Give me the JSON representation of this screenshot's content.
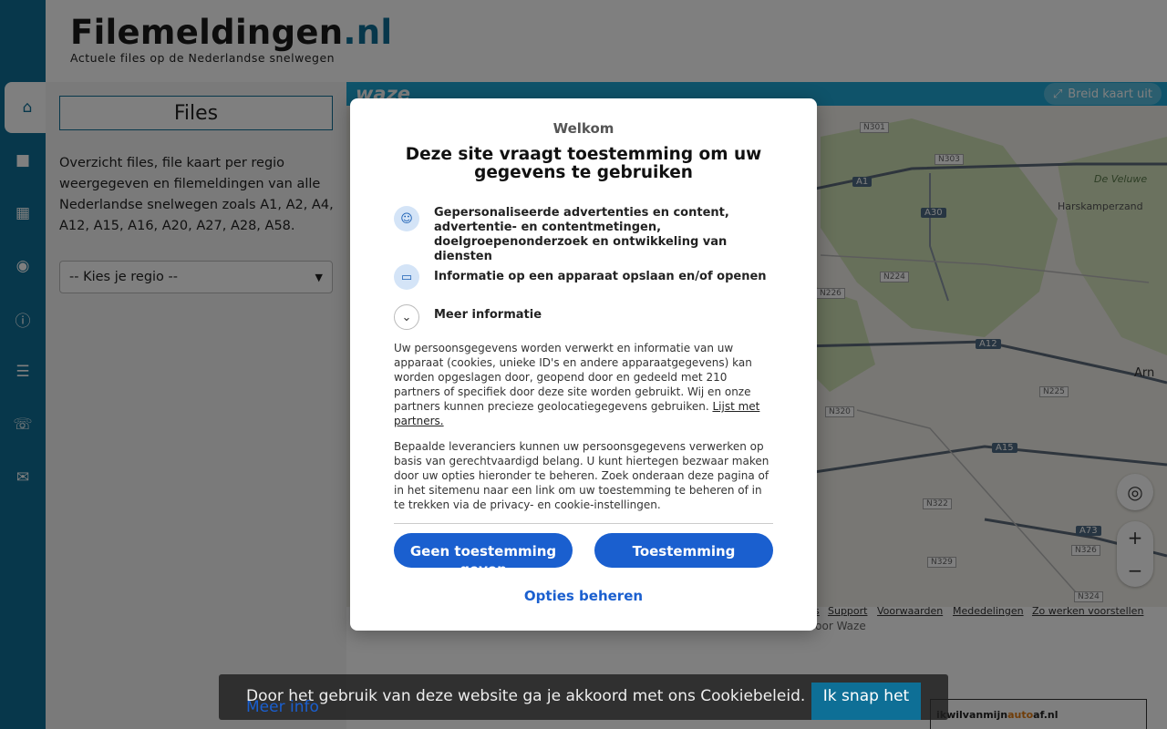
{
  "header": {
    "logo_main": "Filemeldingen",
    "logo_tld": ".nl",
    "tagline": "Actuele files op de Nederlandse snelwegen"
  },
  "rail": {
    "icons": [
      "home-icon",
      "car-icon",
      "map-icon",
      "camera-icon",
      "info-icon",
      "list-icon",
      "phone-icon",
      "mail-icon"
    ]
  },
  "panel": {
    "files_label": "Files",
    "intro": "Overzicht files, file kaart per regio weergegeven en filemeldingen van alle Nederlandse snelwegen zoals A1, A2, A4, A12, A15, A16, A20, A27, A28, A58.",
    "region_select": "-- Kies je regio --"
  },
  "map": {
    "waze_logo": "waze",
    "breid_label": "Breid kaart uit",
    "footer_links": [
      "s",
      "Support",
      "Voorwaarden",
      "Mededelingen",
      "Zo werken voorstellen"
    ],
    "powered": "t door Waze",
    "labels": [
      {
        "text": "A1"
      },
      {
        "text": "A30"
      },
      {
        "text": "A12"
      },
      {
        "text": "A15"
      },
      {
        "text": "A73"
      },
      {
        "text": "N301"
      },
      {
        "text": "N303"
      },
      {
        "text": "N224"
      },
      {
        "text": "N226"
      },
      {
        "text": "N225"
      },
      {
        "text": "N320"
      },
      {
        "text": "N322"
      },
      {
        "text": "N326"
      },
      {
        "text": "N329"
      },
      {
        "text": "N324"
      },
      {
        "text": "Harskamperzand"
      },
      {
        "text": "De Veluwe"
      },
      {
        "text": "Arn"
      }
    ]
  },
  "modal": {
    "welcome": "Welkom",
    "title": "Deze site vraagt toestemming om uw gegevens te gebruiken",
    "purpose_1": "Gepersonaliseerde advertenties en content, advertentie- en contentmetingen, doelgroepenonderzoek en ontwikkeling van diensten",
    "purpose_2": "Informatie op een apparaat opslaan en/of openen",
    "more_info": "Meer informatie",
    "body_1": "Uw persoonsgegevens worden verwerkt en informatie van uw apparaat (cookies, unieke ID's en andere apparaatgegevens) kan worden opgeslagen door, geopend door en gedeeld met 210 partners of specifiek door deze site worden gebruikt. Wij en onze partners kunnen precieze geolocatiegegevens gebruiken.",
    "partners_link": "Lijst met partners.",
    "body_2": "Bepaalde leveranciers kunnen uw persoonsgegevens verwerken op basis van gerechtvaardigd belang. U kunt hiertegen bezwaar maken door uw opties hieronder te beheren. Zoek onderaan deze pagina of in het sitemenu naar een link om uw toestemming te beheren of in te trekken via de privacy- en cookie-instellingen.",
    "decline_button": "Geen toestemming geven",
    "accept_button": "Toestemming",
    "manage_button": "Opties beheren"
  },
  "cookie_bar": {
    "text": "Door het gebruik van deze website ga je akkoord met ons Cookiebeleid.",
    "more": "Meer info",
    "button": "Ik snap het"
  },
  "ads": {
    "ad_prefix": "ikwilvanmijn",
    "ad_highlight": "auto",
    "ad_suffix": "af.nl"
  }
}
